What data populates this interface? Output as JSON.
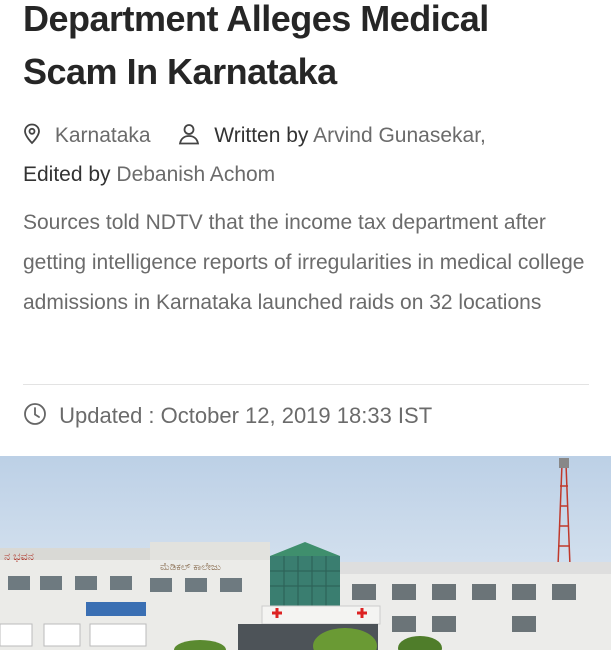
{
  "article": {
    "headline_line1": "Department Alleges Medical",
    "headline_line2": "Scam In Karnataka",
    "location": "Karnataka",
    "written_by_label": "Written by",
    "author": "Arvind Gunasekar,",
    "edited_by_label": "Edited by",
    "editor": "Debanish Achom",
    "summary": "Sources told NDTV that the income tax department after getting intelligence reports of irregularities in medical college admissions in Karnataka launched raids on 32 locations",
    "updated": "Updated : October 12, 2019 18:33 IST"
  },
  "icons": {
    "location": "location-pin-icon",
    "author": "person-icon",
    "updated": "clock-icon"
  },
  "colors": {
    "headline": "#262626",
    "muted_text": "#6b6b6b",
    "divider": "#e3e3e3"
  }
}
